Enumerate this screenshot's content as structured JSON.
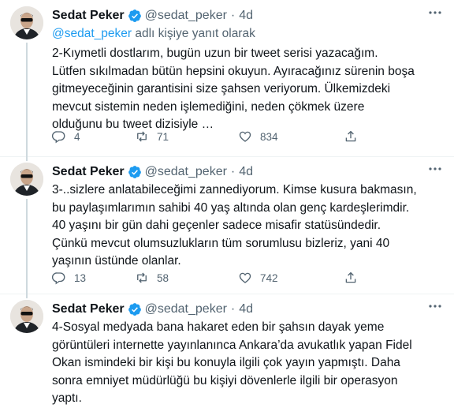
{
  "tweets": [
    {
      "name": "Sedat Peker",
      "handle": "@sedat_peker",
      "separator": "·",
      "time": "4d",
      "reply_handle": "@sedat_peker",
      "reply_suffix": " adlı kişiye yanıt olarak",
      "text": "2-Kıymetli dostlarım, bugün uzun bir tweet serisi yazacağım.\nLütfen sıkılmadan bütün hepsini okuyun. Ayıracağınız sürenin boşa\ngitmeyeceğinin garantisini size şahsen veriyorum. Ülkemizdeki\nmevcut sistemin neden işlemediğini, neden çökmek üzere\nolduğunu bu tweet dizisiyle …",
      "replies": "4",
      "retweets": "71",
      "likes": "834"
    },
    {
      "name": "Sedat Peker",
      "handle": "@sedat_peker",
      "separator": "·",
      "time": "4d",
      "text": "3-..sizlere anlatabileceğimi zannediyorum. Kimse kusura bakmasın,\nbu paylaşımlarımın sahibi 40 yaş altında olan genç kardeşlerimdir.\n40 yaşını bir gün dahi geçenler sadece misafir statüsündedir.\nÇünkü mevcut olumsuzlukların tüm sorumlusu bizleriz, yani 40\nyaşının üstünde olanlar.",
      "replies": "13",
      "retweets": "58",
      "likes": "742"
    },
    {
      "name": "Sedat Peker",
      "handle": "@sedat_peker",
      "separator": "·",
      "time": "4d",
      "text": "4-Sosyal medyada bana hakaret eden bir şahsın dayak yeme\ngörüntüleri internette yayınlanınca Ankara’da avukatlık yapan Fidel\nOkan ismindeki bir kişi bu konuyla ilgili çok yayın yapmıştı. Daha\nsonra emniyet müdürlüğü bu kişiyi dövenlerle ilgili bir operasyon\nyaptı."
    }
  ],
  "icons": {
    "verified": "verified-badge-icon",
    "more": "more-icon",
    "reply": "reply-icon",
    "retweet": "retweet-icon",
    "like": "heart-icon",
    "share": "share-icon"
  },
  "colors": {
    "accent": "#1d9bf0",
    "secondary_text": "#536471",
    "thread_line": "#cfd9de"
  }
}
